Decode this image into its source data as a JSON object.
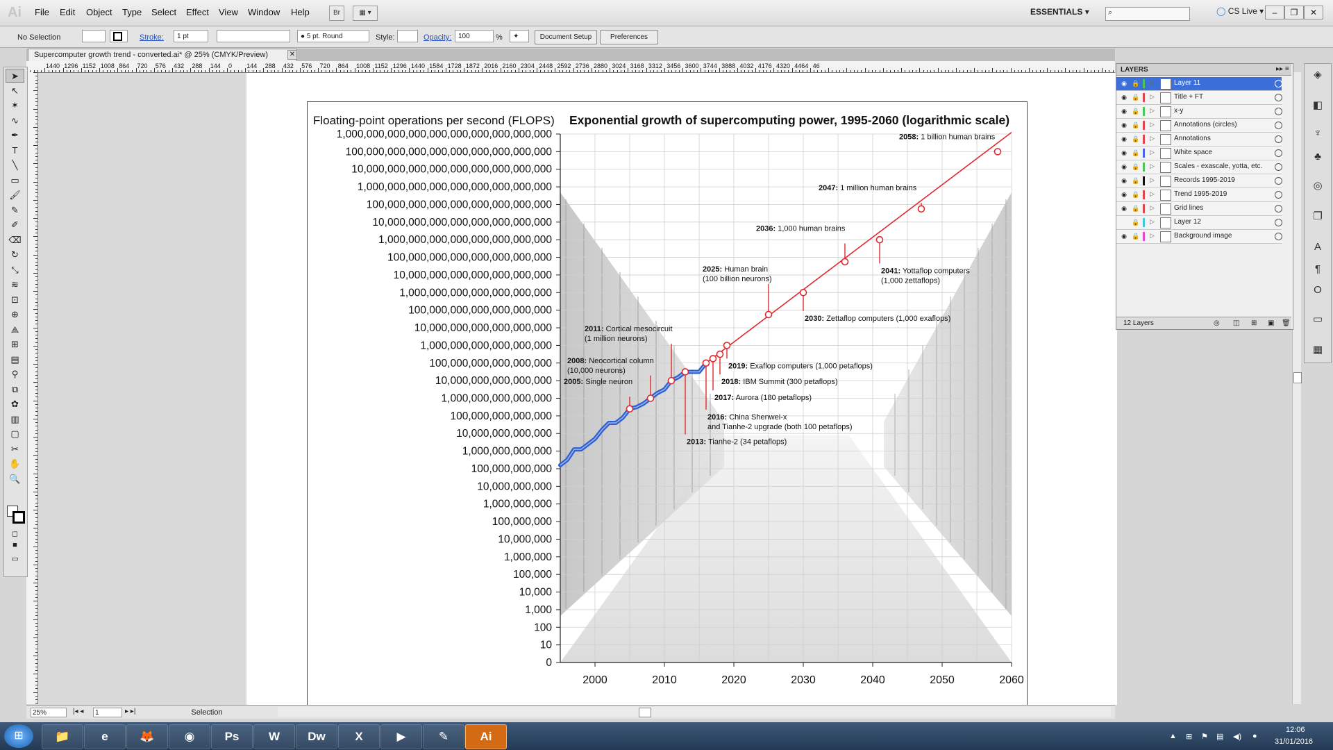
{
  "menu": {
    "app_logo": "Ai",
    "items": [
      "File",
      "Edit",
      "Object",
      "Type",
      "Select",
      "Effect",
      "View",
      "Window",
      "Help"
    ],
    "bridge_label": "Br",
    "workspace": "ESSENTIALS",
    "cs_live": "CS Live"
  },
  "window_controls": {
    "minimize": "–",
    "restore": "❐",
    "close": "✕"
  },
  "control_bar": {
    "selection": "No Selection",
    "stroke_label": "Stroke:",
    "stroke_value": "1 pt",
    "brush": "5 pt. Round",
    "style_label": "Style:",
    "opacity_label": "Opacity:",
    "opacity_value": "100",
    "percent": "%",
    "document_setup": "Document Setup",
    "preferences": "Preferences"
  },
  "document_tab": {
    "title": "Supercomputer growth trend - converted.ai* @ 25% (CMYK/Preview)",
    "close": "✕"
  },
  "status_bar": {
    "zoom": "25%",
    "page": "1",
    "tool": "Selection"
  },
  "ruler_top": [
    "1440",
    "1296",
    "1152",
    "1008",
    "864",
    "720",
    "576",
    "432",
    "288",
    "144",
    "0",
    "144",
    "288",
    "432",
    "576",
    "720",
    "864",
    "1008",
    "1152",
    "1296",
    "1440",
    "1584",
    "1728",
    "1872",
    "2016",
    "2160",
    "2304",
    "2448",
    "2592",
    "2736",
    "2880",
    "3024",
    "3168",
    "3312",
    "3456",
    "3600",
    "3744",
    "3888",
    "4032",
    "4176",
    "4320",
    "4464",
    "46"
  ],
  "layers_panel": {
    "title": "LAYERS",
    "count": "12 Layers",
    "layers": [
      {
        "name": "Layer 11",
        "color": "#4cc55b",
        "selected": true
      },
      {
        "name": "Title + FT",
        "color": "#e0474c"
      },
      {
        "name": "x-y",
        "color": "#4cc55b"
      },
      {
        "name": "Annotations (circles)",
        "color": "#e0474c"
      },
      {
        "name": "Annotations",
        "color": "#e0474c"
      },
      {
        "name": "White space",
        "color": "#4f63e6"
      },
      {
        "name": "Scales - exascale, yotta, etc.",
        "color": "#4cc55b"
      },
      {
        "name": "Records 1995-2019",
        "color": "#111111"
      },
      {
        "name": "Trend 1995-2019",
        "color": "#e0474c"
      },
      {
        "name": "Grid lines",
        "color": "#e0474c"
      },
      {
        "name": "Layer 12",
        "color": "#43c6d6"
      },
      {
        "name": "Background image",
        "color": "#e24ad4"
      }
    ]
  },
  "taskbar": {
    "apps": [
      {
        "name": "explorer",
        "label": "📁"
      },
      {
        "name": "internet-explorer",
        "label": "e"
      },
      {
        "name": "firefox",
        "label": "🦊"
      },
      {
        "name": "chrome",
        "label": "◉"
      },
      {
        "name": "photoshop",
        "label": "Ps"
      },
      {
        "name": "word",
        "label": "W"
      },
      {
        "name": "dreamweaver",
        "label": "Dw"
      },
      {
        "name": "excel",
        "label": "X"
      },
      {
        "name": "media-player",
        "label": "▶"
      },
      {
        "name": "notes",
        "label": "✎"
      },
      {
        "name": "illustrator",
        "label": "Ai"
      }
    ],
    "time": "12:06",
    "date": "31/01/2016"
  },
  "chart_data": {
    "type": "line",
    "title": "Exponential growth of supercomputing power, 1995-2060 (logarithmic scale)",
    "ylabel": "Floating-point operations per second (FLOPS)",
    "y_scale": "log",
    "yticks": [
      "0",
      "10",
      "100",
      "1,000",
      "10,000",
      "100,000",
      "1,000,000",
      "10,000,000",
      "100,000,000",
      "1,000,000,000",
      "10,000,000,000",
      "100,000,000,000",
      "1,000,000,000,000",
      "10,000,000,000,000",
      "100,000,000,000,000",
      "1,000,000,000,000,000",
      "10,000,000,000,000,000",
      "100,000,000,000,000,000",
      "1,000,000,000,000,000,000",
      "10,000,000,000,000,000,000",
      "100,000,000,000,000,000,000",
      "1,000,000,000,000,000,000,000",
      "10,000,000,000,000,000,000,000",
      "100,000,000,000,000,000,000,000",
      "1,000,000,000,000,000,000,000,000",
      "10,000,000,000,000,000,000,000,000",
      "100,000,000,000,000,000,000,000,000",
      "1,000,000,000,000,000,000,000,000,000",
      "10,000,000,000,000,000,000,000,000,000",
      "100,000,000,000,000,000,000,000,000,000",
      "1,000,000,000,000,000,000,000,000,000,000"
    ],
    "xticks": [
      2000,
      2010,
      2020,
      2030,
      2040,
      2050,
      2060
    ],
    "xlim": [
      1995,
      2060
    ],
    "ylim_exponent": [
      0,
      30
    ],
    "grid": true,
    "series": [
      {
        "points": [
          [
            1995,
            11.2
          ],
          [
            1996,
            11.5
          ],
          [
            1997,
            12.1
          ],
          [
            1998,
            12.1
          ],
          [
            1999,
            12.4
          ],
          [
            2000,
            12.7
          ],
          [
            2001,
            13.2
          ],
          [
            2002,
            13.6
          ],
          [
            2003,
            13.6
          ],
          [
            2004,
            13.9
          ],
          [
            2005,
            14.4
          ],
          [
            2006,
            14.5
          ],
          [
            2007,
            14.7
          ],
          [
            2008,
            15.0
          ],
          [
            2009,
            15.3
          ],
          [
            2010,
            15.5
          ],
          [
            2011,
            16.0
          ],
          [
            2012,
            16.2
          ],
          [
            2013,
            16.5
          ],
          [
            2014,
            16.5
          ],
          [
            2015,
            16.5
          ],
          [
            2016,
            17.0
          ]
        ]
      },
      {
        "points": [
          [
            2016,
            17.0
          ],
          [
            2058,
            29.5
          ]
        ]
      }
    ],
    "milestones": [
      {
        "year": "2005:",
        "text": "Single neuron",
        "x": 2005,
        "y": 14.4,
        "label_y": 15.8,
        "side": "above"
      },
      {
        "year": "2008:",
        "text": "Neocortical column",
        "text2": "(10,000 neurons)",
        "x": 2008,
        "y": 15.0,
        "label_y": 17.0,
        "side": "above"
      },
      {
        "year": "2011:",
        "text": "Cortical mesocircuit",
        "text2": "(1 million neurons)",
        "x": 2011,
        "y": 16.0,
        "label_y": 18.8,
        "side": "above"
      },
      {
        "year": "2013:",
        "text": "Tianhe-2 (34 petaflops)",
        "x": 2013,
        "y": 16.5,
        "label_y": 12.4,
        "side": "below"
      },
      {
        "year": "2016:",
        "text": "China Shenwei-x",
        "text2": "and Tianhe-2 upgrade (both 100 petaflops)",
        "x": 2016,
        "y": 17.0,
        "label_y": 13.8,
        "side": "below"
      },
      {
        "year": "2017:",
        "text": "Aurora (180 petaflops)",
        "x": 2017,
        "y": 17.25,
        "label_y": 14.9,
        "side": "below"
      },
      {
        "year": "2018:",
        "text": "IBM Summit (300 petaflops)",
        "x": 2018,
        "y": 17.5,
        "label_y": 15.8,
        "side": "below"
      },
      {
        "year": "2019:",
        "text": "Exaflop computers (1,000 petaflops)",
        "x": 2019,
        "y": 18.0,
        "label_y": 16.7,
        "side": "below"
      },
      {
        "year": "2025:",
        "text": "Human brain",
        "text2": "(100 billion neurons)",
        "x": 2025,
        "y": 19.75,
        "label_y": 22.2,
        "side": "above"
      },
      {
        "year": "2030:",
        "text": "Zettaflop computers (1,000 exaflops)",
        "x": 2030,
        "y": 21.0,
        "label_y": 19.4,
        "side": "below"
      },
      {
        "year": "2036:",
        "text": "1,000 human brains",
        "x": 2036,
        "y": 22.75,
        "label_y": 24.5,
        "side": "above"
      },
      {
        "year": "2041:",
        "text": "Yottaflop computers",
        "text2": "(1,000 zettaflops)",
        "x": 2041,
        "y": 24.0,
        "label_y": 22.1,
        "side": "below"
      },
      {
        "year": "2047:",
        "text": "1 million human brains",
        "x": 2047,
        "y": 25.75,
        "label_y": 26.8,
        "side": "above"
      },
      {
        "year": "2058:",
        "text": "1 billion human brains",
        "x": 2058,
        "y": 29.0,
        "label_y": 29.7,
        "side": "above"
      }
    ]
  }
}
